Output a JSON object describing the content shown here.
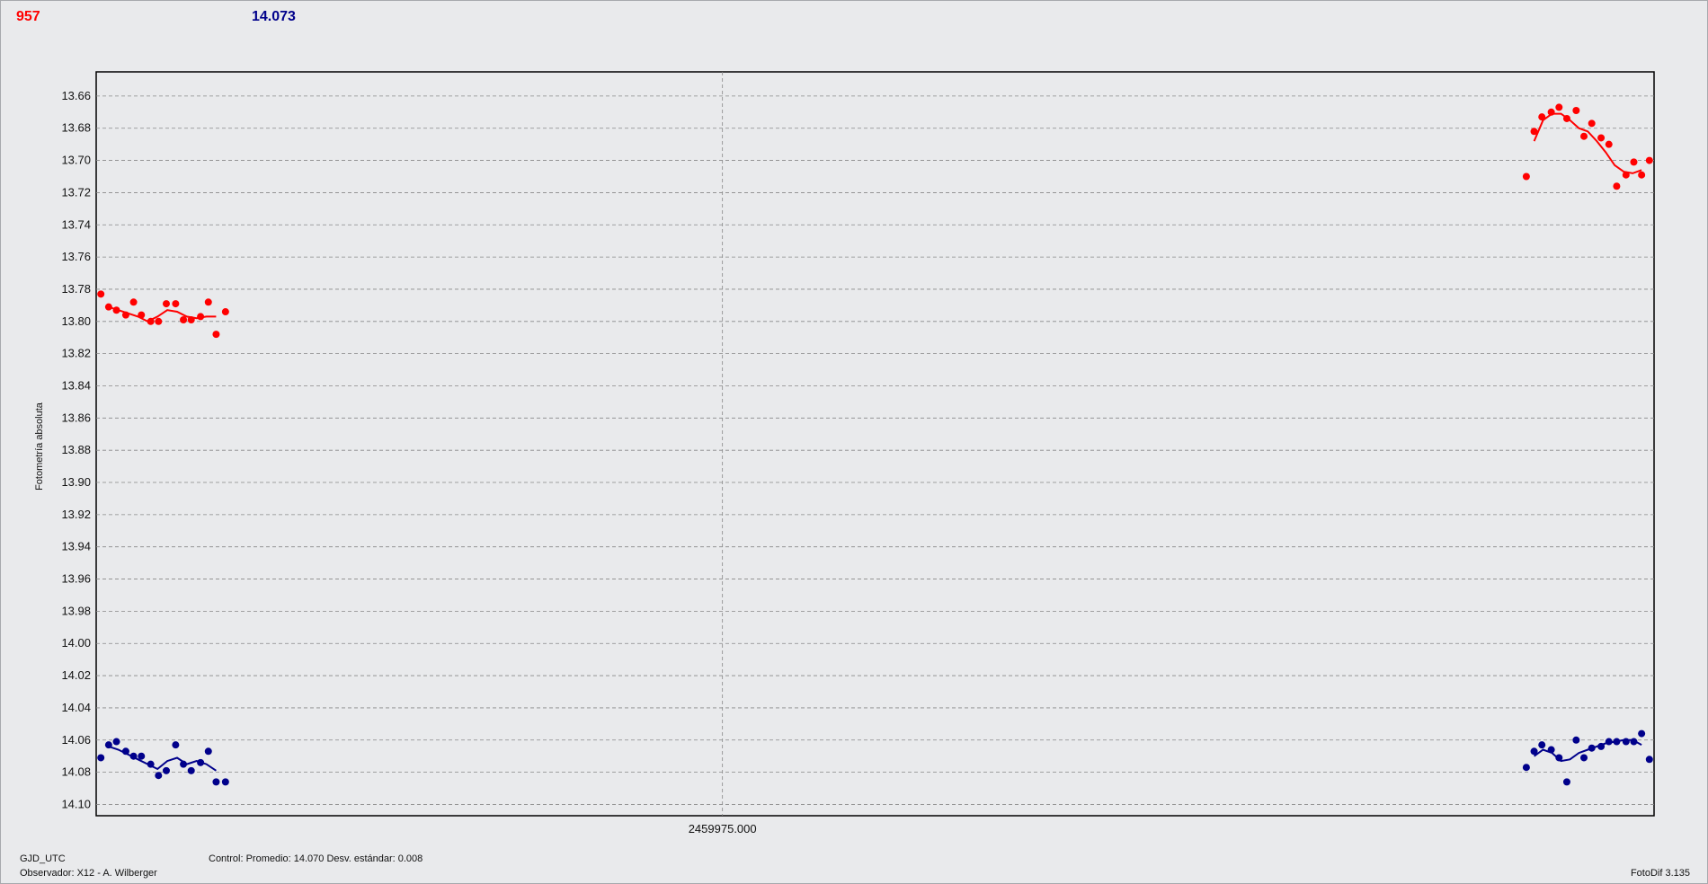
{
  "header": {
    "left_value": "957",
    "right_value": "14.073"
  },
  "footer": {
    "x_axis_name": "GJD_UTC",
    "observer": "Observador: X12 - A. Wilberger",
    "control_stats": "Control: Promedio: 14.070   Desv. estándar: 0.008",
    "version": "FotoDif 3.135"
  },
  "colors": {
    "target": "#ff0000",
    "control": "#00008b",
    "background": "#e9eaec",
    "grid": "#888888"
  },
  "chart_data": {
    "type": "scatter",
    "ylabel": "Fotometría absoluta",
    "xlabel": "GJD_UTC",
    "x_ticks": [
      "2459975.000"
    ],
    "x_positions": [
      0.402
    ],
    "y_ticks": [
      "13.66",
      "13.68",
      "13.70",
      "13.72",
      "13.74",
      "13.76",
      "13.78",
      "13.80",
      "13.82",
      "13.84",
      "13.86",
      "13.88",
      "13.90",
      "13.92",
      "13.94",
      "13.96",
      "13.98",
      "14.00",
      "14.02",
      "14.04",
      "14.06",
      "14.08",
      "14.10"
    ],
    "ylim": [
      13.645,
      14.107
    ],
    "y_inverted": true,
    "grid": true,
    "series": [
      {
        "color": "#ff0000",
        "segments": [
          {
            "x": [
              0.003,
              0.008,
              0.013,
              0.019,
              0.024,
              0.029,
              0.035,
              0.04,
              0.045,
              0.051,
              0.056,
              0.061,
              0.067,
              0.072,
              0.077,
              0.083
            ],
            "y": [
              13.783,
              13.791,
              13.793,
              13.796,
              13.788,
              13.796,
              13.8,
              13.8,
              13.789,
              13.789,
              13.799,
              13.799,
              13.797,
              13.788,
              13.808,
              13.794
            ],
            "trend_y": [
              13.791,
              13.793,
              13.795,
              13.797,
              13.8,
              13.797,
              13.793,
              13.794,
              13.797,
              13.798,
              13.797,
              13.797
            ]
          },
          {
            "x": [
              0.918,
              0.923,
              0.928,
              0.934,
              0.939,
              0.944,
              0.95,
              0.955,
              0.96,
              0.966,
              0.971,
              0.976,
              0.982,
              0.987,
              0.992,
              0.997
            ],
            "y": [
              13.71,
              13.682,
              13.673,
              13.67,
              13.667,
              13.674,
              13.669,
              13.685,
              13.677,
              13.686,
              13.69,
              13.716,
              13.709,
              13.701,
              13.709,
              13.7
            ],
            "trend_y": [
              13.688,
              13.675,
              13.671,
              13.671,
              13.675,
              13.68,
              13.682,
              13.688,
              13.695,
              13.703,
              13.707,
              13.708,
              13.706
            ]
          }
        ]
      },
      {
        "color": "#00008b",
        "segments": [
          {
            "x": [
              0.003,
              0.008,
              0.013,
              0.019,
              0.024,
              0.029,
              0.035,
              0.04,
              0.045,
              0.051,
              0.056,
              0.061,
              0.067,
              0.072,
              0.077,
              0.083
            ],
            "y": [
              14.071,
              14.063,
              14.061,
              14.067,
              14.07,
              14.07,
              14.075,
              14.082,
              14.079,
              14.063,
              14.075,
              14.079,
              14.074,
              14.067,
              14.086,
              14.086
            ],
            "trend_y": [
              14.064,
              14.066,
              14.069,
              14.072,
              14.075,
              14.078,
              14.073,
              14.071,
              14.075,
              14.073,
              14.075,
              14.079
            ]
          },
          {
            "x": [
              0.918,
              0.923,
              0.928,
              0.934,
              0.939,
              0.944,
              0.95,
              0.955,
              0.96,
              0.966,
              0.971,
              0.976,
              0.982,
              0.987,
              0.992,
              0.997
            ],
            "y": [
              14.077,
              14.067,
              14.063,
              14.066,
              14.071,
              14.086,
              14.06,
              14.071,
              14.065,
              14.064,
              14.061,
              14.061,
              14.061,
              14.061,
              14.056,
              14.072
            ],
            "trend_y": [
              14.07,
              14.066,
              14.068,
              14.073,
              14.072,
              14.068,
              14.066,
              14.064,
              14.062,
              14.061,
              14.06,
              14.06,
              14.063
            ]
          }
        ]
      }
    ]
  }
}
